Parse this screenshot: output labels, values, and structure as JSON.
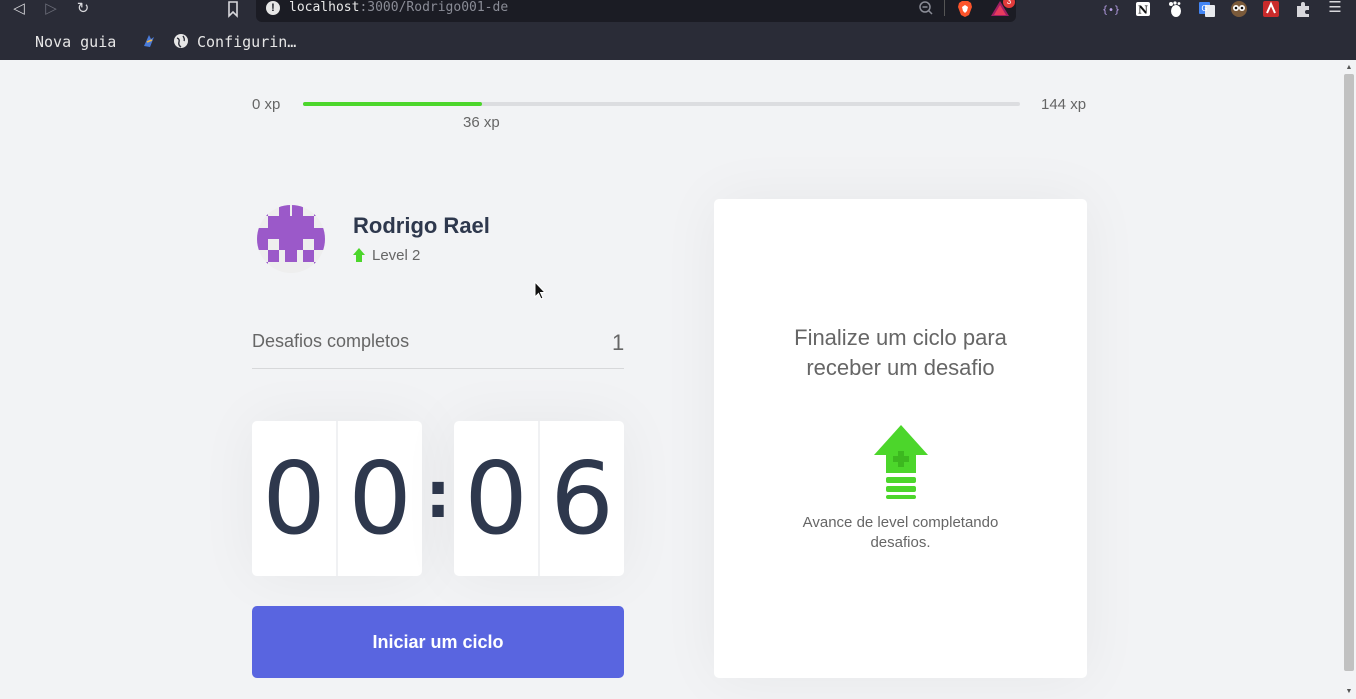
{
  "browser": {
    "url_host": "localhost",
    "url_path": ":3000/Rodrigo001-de",
    "rewards_badge": "3",
    "bookmarks": [
      {
        "label": "Nova guia"
      },
      {
        "label": "Configurin…"
      }
    ]
  },
  "experience": {
    "min_label": "0 xp",
    "max_label": "144 xp",
    "current_label": "36 xp",
    "progress_percent": 25,
    "bar_color": "#4cd62b"
  },
  "profile": {
    "name": "Rodrigo Rael",
    "level_label": "Level 2",
    "avatar_color": "#9b59c9"
  },
  "challenges": {
    "label": "Desafios completos",
    "count": "1"
  },
  "countdown": {
    "minute_left": "0",
    "minute_right": "0",
    "separator": ":",
    "second_left": "0",
    "second_right": "6"
  },
  "start_button": {
    "label": "Iniciar um ciclo",
    "color": "#5965e0"
  },
  "challenge_box": {
    "title": "Finalize um ciclo para receber um desafio",
    "description": "Avance de level completando desafios.",
    "icon": "level-up-icon"
  }
}
